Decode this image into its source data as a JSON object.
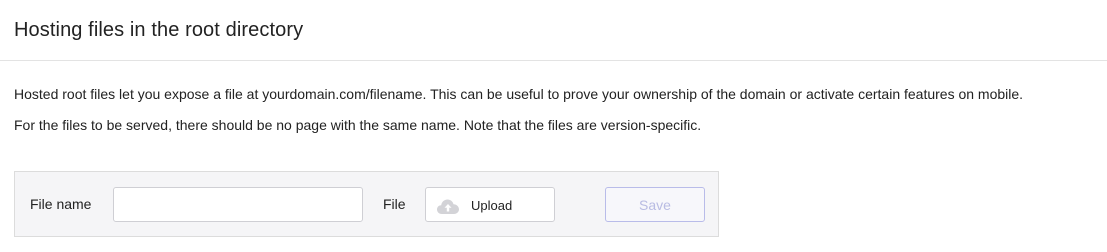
{
  "section": {
    "title": "Hosting files in the root directory",
    "description_line1": "Hosted root files let you expose a file at yourdomain.com/filename. This can be useful to prove your ownership of the domain or activate certain features on mobile.",
    "description_line2": "For the files to be served, there should be no page with the same name. Note that the files are version-specific."
  },
  "form": {
    "file_name_label": "File name",
    "file_name_value": "",
    "file_name_placeholder": "",
    "file_label": "File",
    "upload_label": "Upload",
    "upload_icon": "cloud-upload-icon",
    "save_label": "Save",
    "save_enabled": false
  },
  "colors": {
    "save_disabled_text": "#b9bce3",
    "save_disabled_border": "#b9bce9",
    "panel_background": "#f5f5f7"
  }
}
